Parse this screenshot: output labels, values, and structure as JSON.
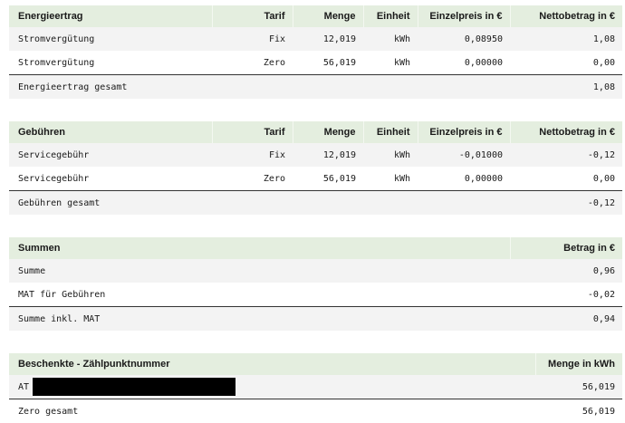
{
  "energieertrag": {
    "headers": [
      "Energieertrag",
      "Tarif",
      "Menge",
      "Einheit",
      "Einzelpreis in €",
      "Nettobetrag in €"
    ],
    "rows": [
      [
        "Stromvergütung",
        "Fix",
        "12,019",
        "kWh",
        "0,08950",
        "1,08"
      ],
      [
        "Stromvergütung",
        "Zero",
        "56,019",
        "kWh",
        "0,00000",
        "0,00"
      ]
    ],
    "total_label": "Energieertrag gesamt",
    "total_value": "1,08"
  },
  "gebuehren": {
    "headers": [
      "Gebühren",
      "Tarif",
      "Menge",
      "Einheit",
      "Einzelpreis in €",
      "Nettobetrag in €"
    ],
    "rows": [
      [
        "Servicegebühr",
        "Fix",
        "12,019",
        "kWh",
        "-0,01000",
        "-0,12"
      ],
      [
        "Servicegebühr",
        "Zero",
        "56,019",
        "kWh",
        "0,00000",
        "0,00"
      ]
    ],
    "total_label": "Gebühren gesamt",
    "total_value": "-0,12"
  },
  "summen": {
    "headers": [
      "Summen",
      "Betrag in €"
    ],
    "rows": [
      [
        "Summe",
        "0,96"
      ],
      [
        "MAT für Gebühren",
        "-0,02"
      ]
    ],
    "total_label": "Summe inkl. MAT",
    "total_value": "0,94"
  },
  "beschenkte": {
    "headers": [
      "Beschenkte - Zählpunktnummer",
      "Menge in kWh"
    ],
    "rows": [
      [
        "AT",
        "56,019"
      ]
    ],
    "total_label": "Zero gesamt",
    "total_value": "56,019"
  }
}
